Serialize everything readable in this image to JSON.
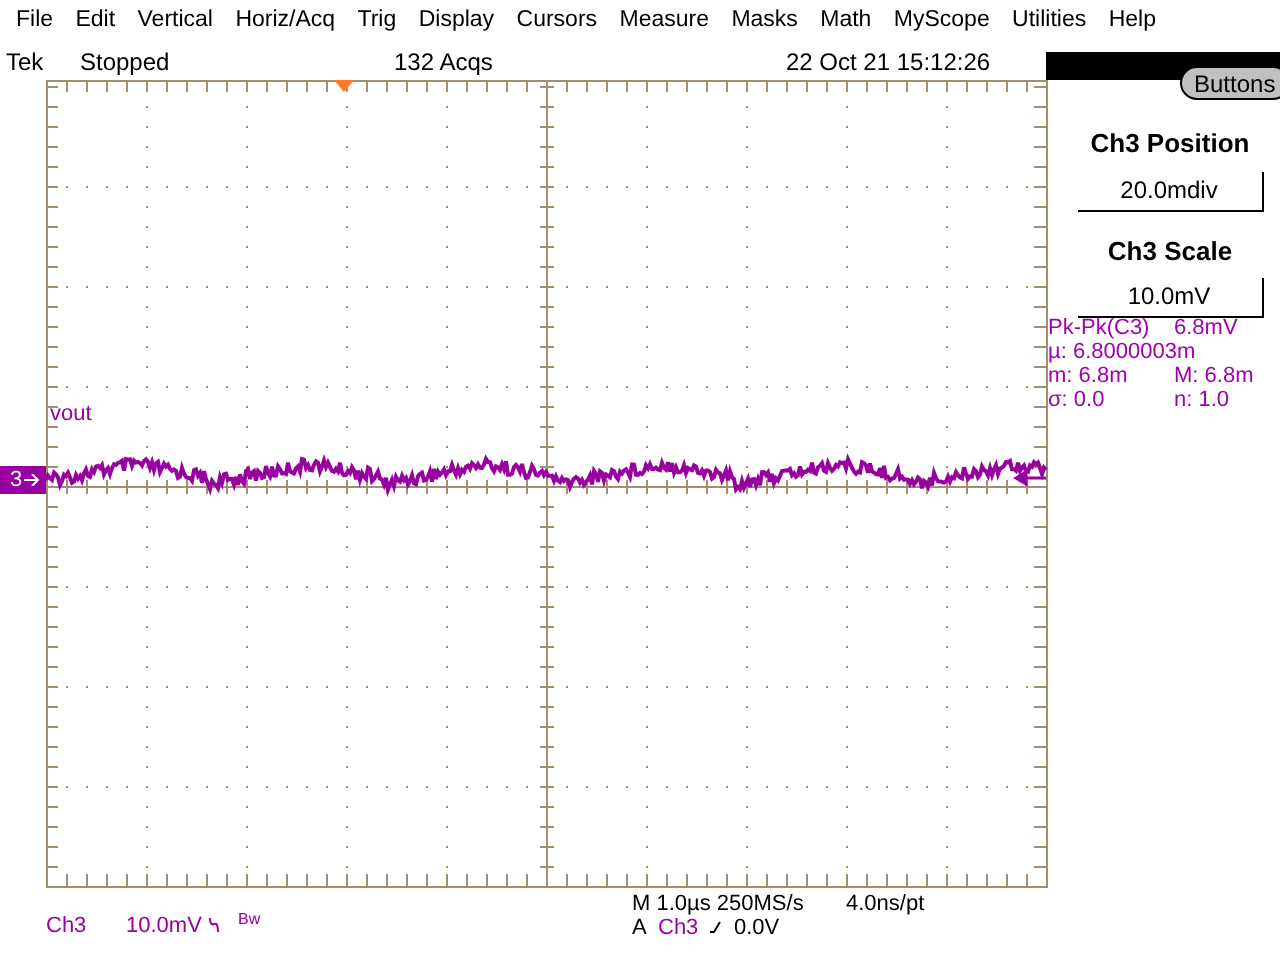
{
  "menu": [
    "File",
    "Edit",
    "Vertical",
    "Horiz/Acq",
    "Trig",
    "Display",
    "Cursors",
    "Measure",
    "Masks",
    "Math",
    "MyScope",
    "Utilities",
    "Help"
  ],
  "status": {
    "brand": "Tek",
    "run_state": "Stopped",
    "acquisitions": "132 Acqs",
    "datetime": "22 Oct 21 15:12:26"
  },
  "panel": {
    "button": "Buttons",
    "controls": [
      {
        "title": "Ch3 Position",
        "value": "20.0mdiv"
      },
      {
        "title": "Ch3 Scale",
        "value": "10.0mV"
      }
    ],
    "measurement": {
      "name": "Pk-Pk(C3)",
      "value": "6.8mV",
      "mean": "µ: 6.8000003m",
      "min": "m: 6.8m",
      "max": "M: 6.8m",
      "sigma": "σ: 0.0",
      "count": "n: 1.0"
    }
  },
  "display": {
    "trace_label": "vout",
    "channel_marker": "3"
  },
  "readouts": {
    "channel": "Ch3",
    "scale": "10.0mV",
    "bandwidth": "Bw",
    "timebase": "M 1.0µs 250MS/s",
    "resolution": "4.0ns/pt",
    "trigger_mode": "A",
    "trigger_source": "Ch3",
    "trigger_level": "0.0V"
  }
}
